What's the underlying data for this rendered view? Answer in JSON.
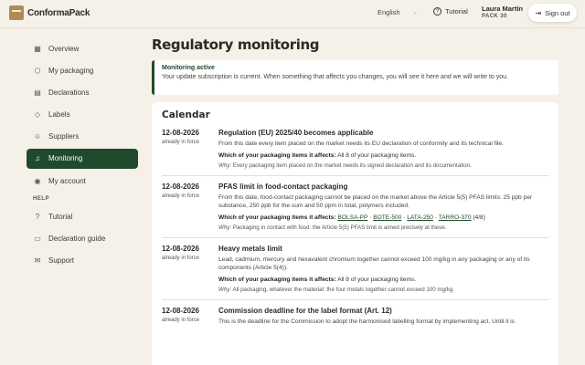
{
  "header": {
    "logo_text": "ConformaPack",
    "language": "English",
    "tutorial": "Tutorial",
    "user_name": "Laura Martín",
    "user_pack": "PACK 30",
    "sign_out": "Sign out"
  },
  "sidebar": {
    "items": [
      {
        "label": "Overview",
        "icon": "grid-icon"
      },
      {
        "label": "My packaging",
        "icon": "box-icon"
      },
      {
        "label": "Declarations",
        "icon": "document-icon"
      },
      {
        "label": "Labels",
        "icon": "tag-icon"
      },
      {
        "label": "Suppliers",
        "icon": "users-icon"
      },
      {
        "label": "Monitoring",
        "icon": "bell-icon"
      },
      {
        "label": "My account",
        "icon": "user-icon"
      }
    ],
    "help_label": "HELP",
    "help_items": [
      {
        "label": "Tutorial",
        "icon": "help-circle-icon"
      },
      {
        "label": "Declaration guide",
        "icon": "book-icon"
      },
      {
        "label": "Support",
        "icon": "mail-icon"
      }
    ]
  },
  "main": {
    "title": "Regulatory monitoring",
    "notice_title": "Monitoring active",
    "notice_text": "Your update subscription is current. When something that affects you changes, you will see it here and we will write to you.",
    "calendar_title": "Calendar",
    "events": [
      {
        "date": "12-08-2026",
        "status": "already in force",
        "title": "Regulation (EU) 2025/40 becomes applicable",
        "desc": "From this date every item placed on the market needs its EU declaration of conformity and its technical file.",
        "affects_label": "Which of your packaging items it affects:",
        "affects": "All 8 of your packaging items.",
        "why_label": "Why:",
        "why": "Every packaging item placed on the market needs its signed declaration and its documentation."
      },
      {
        "date": "12-08-2026",
        "status": "already in force",
        "title": "PFAS limit in food-contact packaging",
        "desc": "From this date, food-contact packaging cannot be placed on the market above the Article 5(5) PFAS limits: 25 ppb per substance, 250 ppb for the sum and 50 ppm in total, polymers included.",
        "affects_label": "Which of your packaging items it affects:",
        "affects_links": [
          "BOLSA-PP",
          "BOTE-500",
          "LATA-250",
          "TARRO-370"
        ],
        "affects_count": "(4/8)",
        "why_label": "Why:",
        "why": "Packaging in contact with food: the Article 5(5) PFAS limit is aimed precisely at these."
      },
      {
        "date": "12-08-2026",
        "status": "already in force",
        "title": "Heavy metals limit",
        "desc": "Lead, cadmium, mercury and hexavalent chromium together cannot exceed 100 mg/kg in any packaging or any of its components (Article 5(4)).",
        "affects_label": "Which of your packaging items it affects:",
        "affects": "All 8 of your packaging items.",
        "why_label": "Why:",
        "why": "All packaging, whatever the material: the four metals together cannot exceed 100 mg/kg."
      },
      {
        "date": "12-08-2026",
        "status": "already in force",
        "title": "Commission deadline for the label format (Art. 12)",
        "desc": "This is the deadline for the Commission to adopt the harmonised labelling format by implementing act. Until it is"
      }
    ]
  }
}
